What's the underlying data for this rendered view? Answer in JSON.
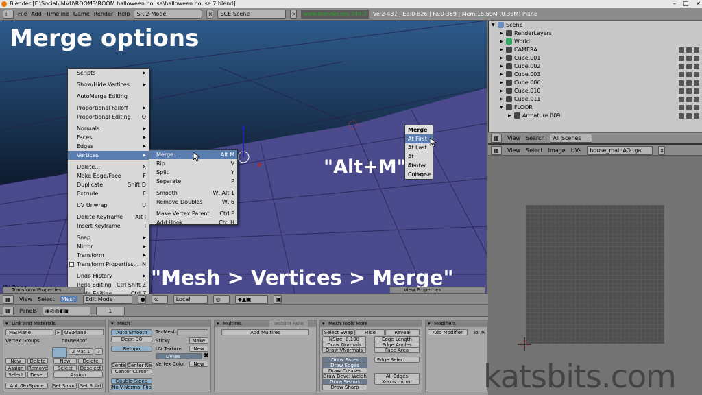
{
  "window": {
    "title": "Blender [F:\\Social\\IMVU\\ROOMS\\ROOM halloween house\\halloween house 7.blend]",
    "controls": [
      "–",
      "□",
      "×"
    ]
  },
  "topbar": {
    "menus": [
      "File",
      "Add",
      "Timeline",
      "Game",
      "Render",
      "Help"
    ],
    "screen": "SR:2-Model",
    "scene": "SCE:Scene",
    "link": "www.blender.org 249.2",
    "stats": "Ve:2-437 | Ed:0-826 | Fa:0-369 | Mem:15.69M (0.39M) Plane"
  },
  "overlay": {
    "title": "Merge options",
    "alt_m": "\"Alt+M\"",
    "path": "\"Mesh > Vertices > Merge\""
  },
  "mesh_menu": {
    "items": [
      {
        "label": "Scripts",
        "sc": "",
        "sub": true
      },
      {
        "sep": true
      },
      {
        "label": "Show/Hide Vertices",
        "sc": "",
        "sub": true
      },
      {
        "sep": true
      },
      {
        "label": "AutoMerge Editing",
        "sc": "",
        "sub": false
      },
      {
        "sep": true
      },
      {
        "label": "Proportional Falloff",
        "sc": "",
        "sub": true
      },
      {
        "label": "Proportional Editing",
        "sc": "O",
        "sub": false
      },
      {
        "sep": true
      },
      {
        "label": "Normals",
        "sc": "",
        "sub": true
      },
      {
        "label": "Faces",
        "sc": "",
        "sub": true
      },
      {
        "label": "Edges",
        "sc": "",
        "sub": true
      },
      {
        "label": "Vertices",
        "sc": "",
        "sub": true,
        "hl": true
      },
      {
        "sep": true
      },
      {
        "label": "Delete...",
        "sc": "X",
        "sub": false
      },
      {
        "label": "Make Edge/Face",
        "sc": "F",
        "sub": false
      },
      {
        "label": "Duplicate",
        "sc": "Shift D",
        "sub": false
      },
      {
        "label": "Extrude",
        "sc": "E",
        "sub": false
      },
      {
        "sep": true
      },
      {
        "label": "UV Unwrap",
        "sc": "U",
        "sub": false
      },
      {
        "sep": true
      },
      {
        "label": "Delete Keyframe",
        "sc": "Alt I",
        "sub": false
      },
      {
        "label": "Insert Keyframe",
        "sc": "I",
        "sub": false
      },
      {
        "sep": true
      },
      {
        "label": "Snap",
        "sc": "",
        "sub": true
      },
      {
        "label": "Mirror",
        "sc": "",
        "sub": true
      },
      {
        "label": "Transform",
        "sc": "",
        "sub": true
      },
      {
        "label": "Transform Properties...",
        "sc": "N",
        "sub": false,
        "chk": true
      },
      {
        "sep": true
      },
      {
        "label": "Undo History",
        "sc": "",
        "sub": true
      },
      {
        "label": "Redo Editing",
        "sc": "Ctrl Shift Z",
        "sub": false
      },
      {
        "label": "Undo Editing",
        "sc": "Ctrl Z",
        "sub": false
      }
    ]
  },
  "vertices_menu": {
    "items": [
      {
        "label": "Merge...",
        "sc": "Alt M",
        "hl": true
      },
      {
        "label": "Rip",
        "sc": "V"
      },
      {
        "label": "Split",
        "sc": "Y"
      },
      {
        "label": "Separate",
        "sc": "P"
      },
      {
        "sep": true
      },
      {
        "label": "Smooth",
        "sc": "W, Alt 1"
      },
      {
        "label": "Remove Doubles",
        "sc": "W, 6"
      },
      {
        "sep": true
      },
      {
        "label": "Make Vertex Parent",
        "sc": "Ctrl P"
      },
      {
        "label": "Add Hook",
        "sc": "Ctrl H"
      }
    ]
  },
  "merge_popup": {
    "header": "Merge",
    "items": [
      "At First",
      "At Last",
      "At Center",
      "At Cursor",
      "Collapse"
    ]
  },
  "outliner": {
    "rows": [
      {
        "label": "Scene",
        "indent": 0
      },
      {
        "label": "RenderLayers",
        "indent": 1
      },
      {
        "label": "World",
        "indent": 1
      },
      {
        "label": "CAMERA",
        "indent": 1
      },
      {
        "label": "Cube.001",
        "indent": 1
      },
      {
        "label": "Cube.002",
        "indent": 1
      },
      {
        "label": "Cube.003",
        "indent": 1
      },
      {
        "label": "Cube.006",
        "indent": 1
      },
      {
        "label": "Cube.010",
        "indent": 1
      },
      {
        "label": "Cube.011",
        "indent": 1
      },
      {
        "label": "FLOOR",
        "indent": 1
      },
      {
        "label": "Armature.009",
        "indent": 2
      }
    ],
    "header": {
      "view": "View",
      "search": "Search",
      "scope": "All Scenes"
    }
  },
  "uv_header": {
    "view": "View",
    "select": "Select",
    "image": "Image",
    "uvs": "UVs",
    "image_name": "house_mainAO.tga"
  },
  "viewport_header": {
    "view": "View",
    "select": "Select",
    "mode_menu": "Mesh",
    "mode": "Edit Mode",
    "pivot": "Local",
    "transform_props_title": "Transform Properties",
    "view_props_title": "View Properties"
  },
  "buttons_header": {
    "panels": "Panels",
    "page": "1"
  },
  "link_materials": {
    "title": "Link and Materials",
    "me": "ME:Plane",
    "f": "F",
    "ob": "OB:Plane",
    "vertex_groups": "Vertex Groups",
    "material_name": "houseRoof",
    "mat_counter": "2 Mat 1",
    "q": "?",
    "new": "New",
    "delete": "Delete",
    "assign": "Assign",
    "remove": "Remove",
    "select": "Select",
    "desel": "Desel.",
    "deselect": "Deselect",
    "autotexspace": "AutoTexSpace",
    "set_smooth": "Set Smoot",
    "set_solid": "Set Solid"
  },
  "mesh_panel": {
    "title": "Mesh",
    "auto_smooth": "Auto Smooth",
    "degr": "Degr: 30",
    "retopo": "Retopo",
    "texmesh": "TexMesh:",
    "sticky": "Sticky",
    "make": "Make",
    "uv_texture": "UV Texture",
    "new": "New",
    "uvtex": "UVTex",
    "vertex_color": "Vertex Color",
    "center": "Center",
    "center_new": "Center New",
    "center_cursor": "Center Cursor",
    "double_sided": "Double Sided",
    "no_vnormal_flip": "No V.Normal Flip"
  },
  "multires": {
    "tab1": "Multires",
    "tab2": "Texture Face",
    "add": "Add Multires"
  },
  "mesh_tools": {
    "title": "Mesh Tools More",
    "select_swap": "Select Swap",
    "hide": "Hide",
    "reveal": "Reveal",
    "nsize": "NSize: 0.100",
    "draw_normals": "Draw Normals",
    "draw_vnormals": "Draw VNormals",
    "edge_length": "Edge Length",
    "edge_angles": "Edge Angles",
    "face_area": "Face Area",
    "draw_faces": "Draw Faces",
    "draw_edges": "Draw Edges",
    "draw_creases": "Draw Creases",
    "draw_bevel": "Draw Bevel Weights",
    "draw_seams": "Draw Seams",
    "draw_sharp": "Draw Sharp",
    "edge_select": "Edge Select",
    "all_edges": "All Edges",
    "x_mirror": "X-axis mirror"
  },
  "modifiers": {
    "title": "Modifiers",
    "add": "Add Modifier",
    "to": "To: Pl"
  },
  "watermark": "katsbits.com"
}
